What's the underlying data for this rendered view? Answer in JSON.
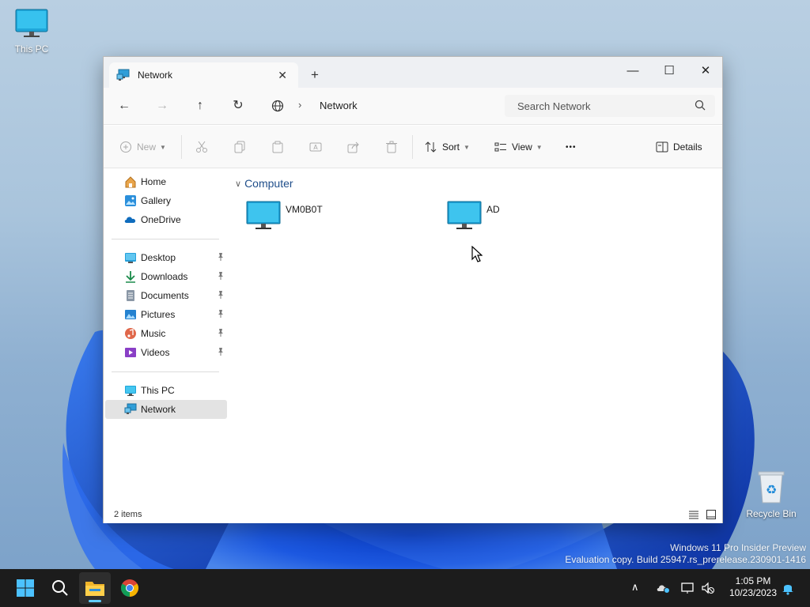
{
  "desktop": {
    "this_pc_label": "This PC",
    "recycle_bin_label": "Recycle Bin",
    "watermark_line1": "Windows 11 Pro Insider Preview",
    "watermark_line2": "Evaluation copy. Build 25947.rs_prerelease.230901-1416"
  },
  "window": {
    "tab_title": "Network",
    "tab_icon": "network-icon",
    "controls": {
      "minimize": "—",
      "maximize": "☐",
      "close": "✕"
    }
  },
  "navbar": {
    "address_text": "Network",
    "search_placeholder": "Search Network"
  },
  "command_bar": {
    "new_label": "New",
    "sort_label": "Sort",
    "view_label": "View",
    "more_label": "•••",
    "details_label": "Details",
    "disabled_actions": [
      "cut",
      "copy",
      "paste",
      "rename",
      "share",
      "delete"
    ]
  },
  "sidebar": {
    "quick": [
      {
        "label": "Home",
        "icon": "home-icon"
      },
      {
        "label": "Gallery",
        "icon": "gallery-icon"
      },
      {
        "label": "OneDrive",
        "icon": "onedrive-icon"
      }
    ],
    "pinned": [
      {
        "label": "Desktop",
        "icon": "desktop-folder-icon"
      },
      {
        "label": "Downloads",
        "icon": "downloads-icon"
      },
      {
        "label": "Documents",
        "icon": "documents-icon"
      },
      {
        "label": "Pictures",
        "icon": "pictures-icon"
      },
      {
        "label": "Music",
        "icon": "music-icon"
      },
      {
        "label": "Videos",
        "icon": "videos-icon"
      }
    ],
    "locations": [
      {
        "label": "This PC",
        "icon": "this-pc-icon"
      },
      {
        "label": "Network",
        "icon": "network-icon",
        "selected": true
      }
    ]
  },
  "content": {
    "group_label": "Computer",
    "items": [
      {
        "label": "VM0B0T",
        "icon": "computer-icon"
      },
      {
        "label": "AD",
        "icon": "computer-icon"
      }
    ]
  },
  "status": {
    "item_count": "2 items"
  },
  "taskbar": {
    "time": "1:05 PM",
    "date": "10/23/2023",
    "accent": "#60cdff"
  }
}
